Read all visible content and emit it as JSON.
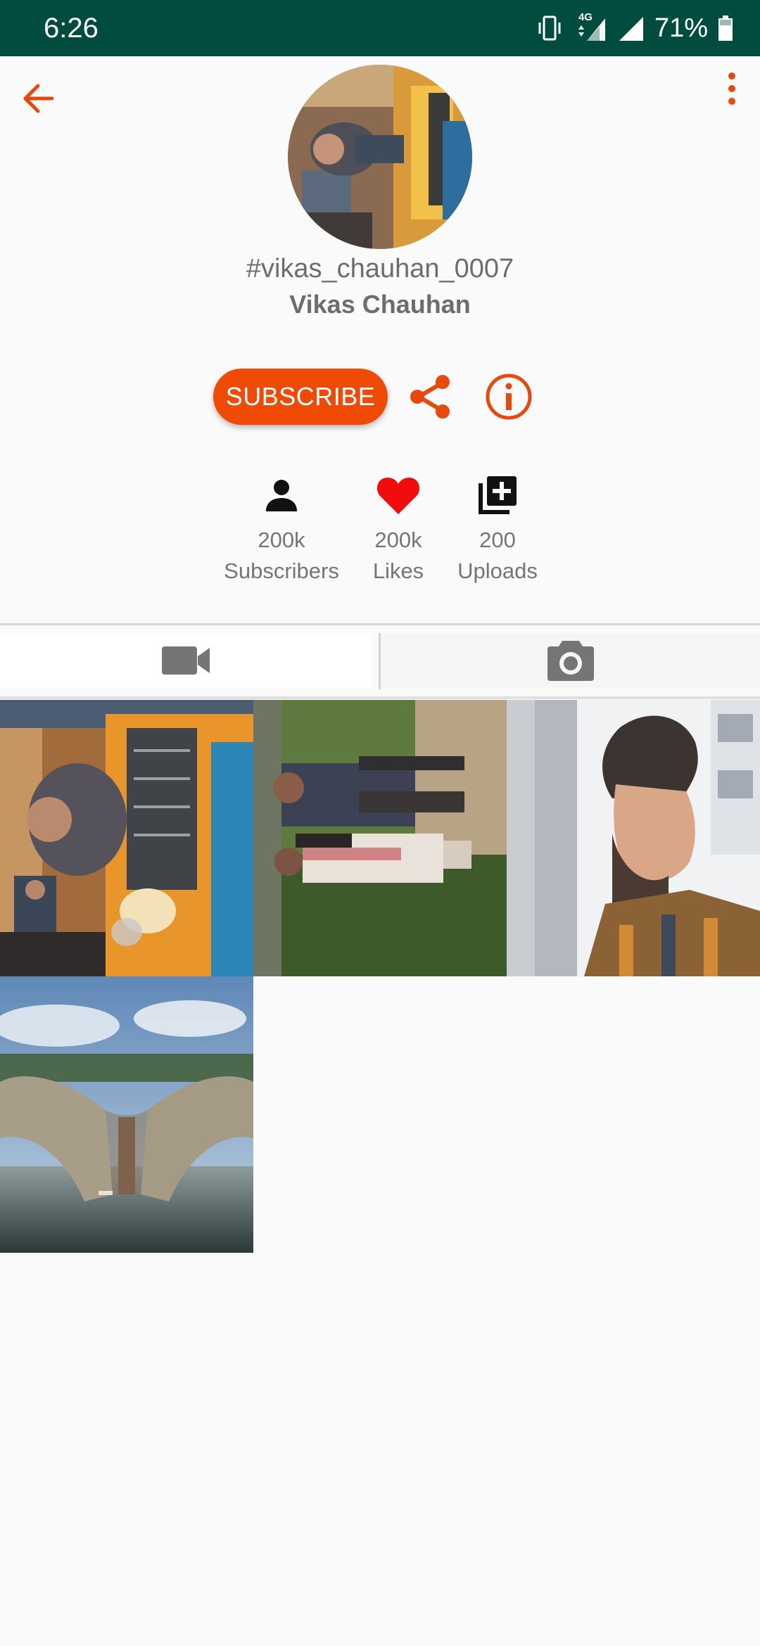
{
  "status_bar": {
    "time": "6:26",
    "network_label": "4G",
    "battery_percent": "71%",
    "icons": [
      "vibrate-icon",
      "data-arrows-icon",
      "signal-icon",
      "signal-icon",
      "battery-icon"
    ]
  },
  "app_bar": {
    "back_icon": "arrow-left-icon",
    "menu_icon": "more-vert-icon"
  },
  "profile": {
    "handle": "#vikas_chauhan_0007",
    "name": "Vikas Chauhan",
    "avatar": "profile-photo"
  },
  "actions": {
    "subscribe_label": "SUBSCRIBE",
    "share_icon": "share-icon",
    "info_icon": "info-icon"
  },
  "stats": [
    {
      "icon": "person-icon",
      "value": "200k",
      "label": "Subscribers"
    },
    {
      "icon": "heart-icon",
      "value": "200k",
      "label": "Likes"
    },
    {
      "icon": "add-library-icon",
      "value": "200",
      "label": "Uploads"
    }
  ],
  "tabs": [
    {
      "icon": "videocam-icon",
      "selected": true
    },
    {
      "icon": "camera-icon",
      "selected": false
    }
  ],
  "media_grid": [
    {
      "kind": "photo",
      "subject": "man seated at restaurant table"
    },
    {
      "kind": "photo",
      "subject": "two people standing outdoors"
    },
    {
      "kind": "photo",
      "subject": "man in profile beside pillar"
    },
    {
      "kind": "photo",
      "subject": "hand-shaped rock sculpture in sea"
    }
  ],
  "colors": {
    "status_bar": "#004d40",
    "accent": "#ef4a06",
    "heart": "#f20d0d",
    "text_gray": "#6d6d6d",
    "background": "#fafafa"
  }
}
